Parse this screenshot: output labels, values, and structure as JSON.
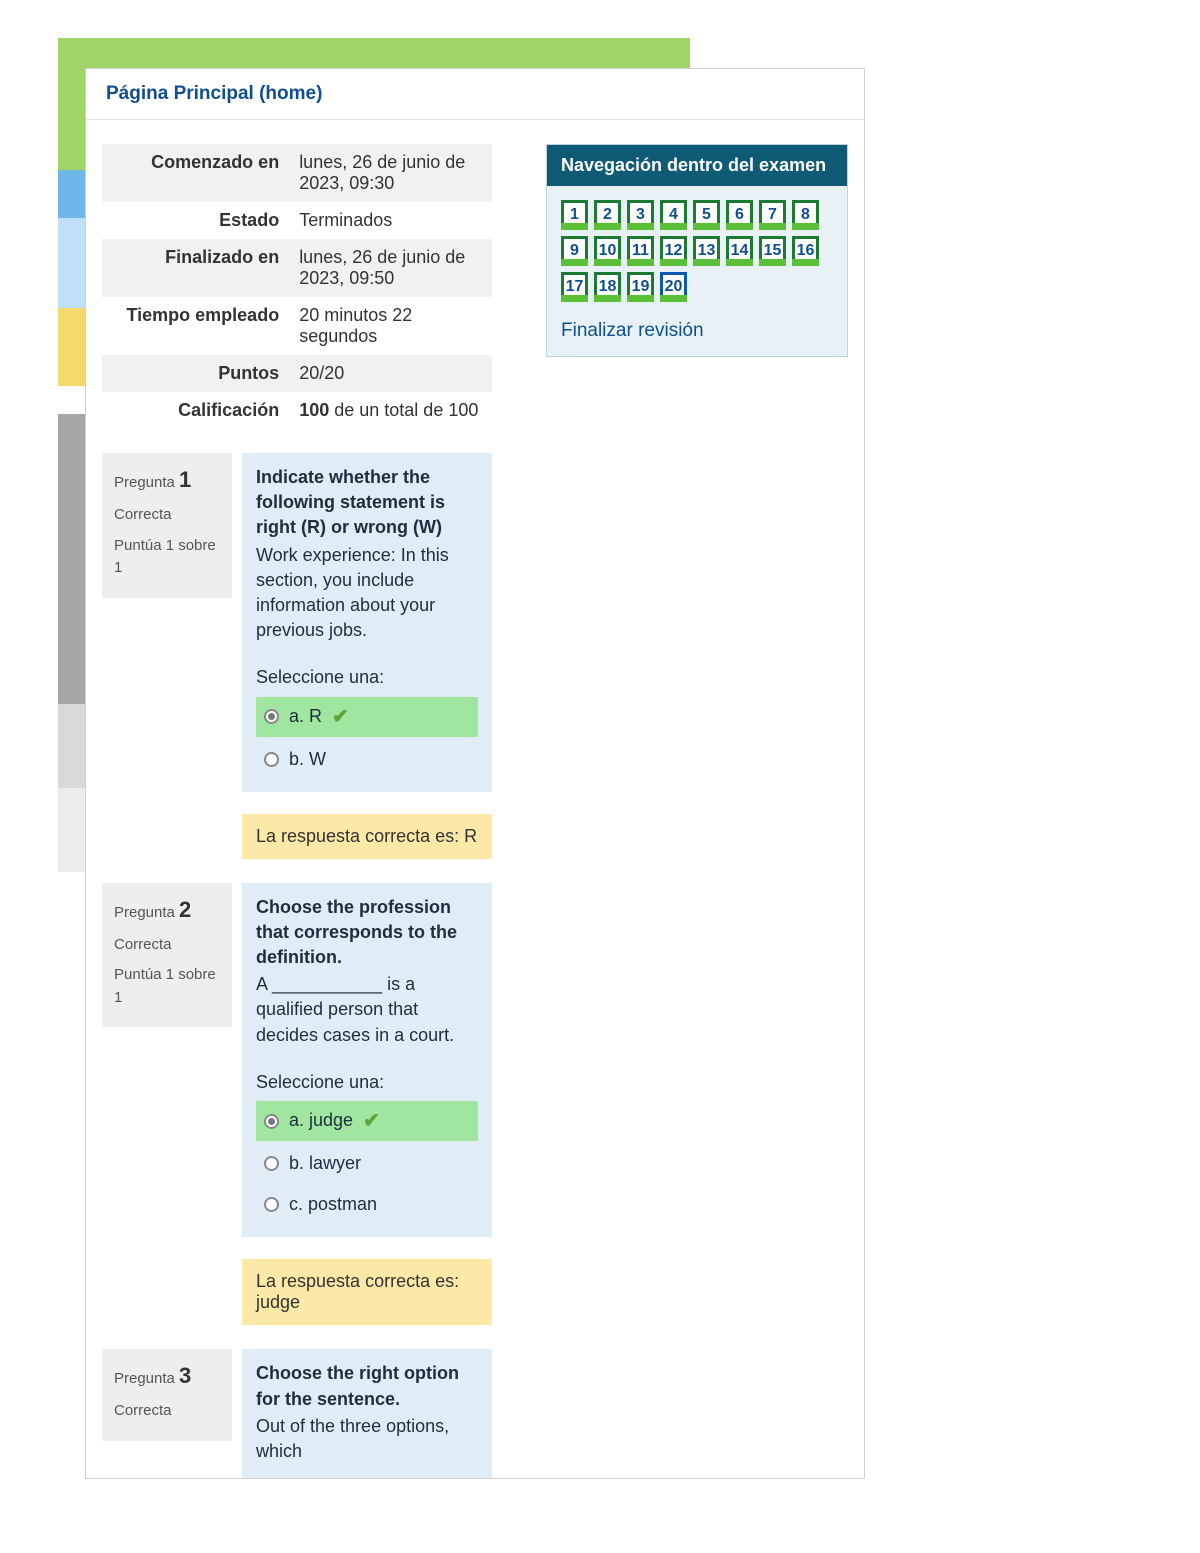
{
  "breadcrumb": {
    "home": "Página Principal (home)"
  },
  "summary": {
    "rows": [
      {
        "label": "Comenzado en",
        "value": "lunes, 26 de junio de 2023, 09:30"
      },
      {
        "label": "Estado",
        "value": "Terminados"
      },
      {
        "label": "Finalizado en",
        "value": "lunes, 26 de junio de 2023, 09:50"
      },
      {
        "label": "Tiempo empleado",
        "value": "20 minutos 22 segundos"
      },
      {
        "label": "Puntos",
        "value": "20/20"
      },
      {
        "label": "Calificación",
        "value_html": [
          "100",
          " de un total de 100"
        ]
      }
    ]
  },
  "labels": {
    "question_prefix": "Pregunta ",
    "select_one": "Seleccione una:",
    "correct_answer_prefix": "La respuesta correcta es: "
  },
  "questions": [
    {
      "number": "1",
      "state": "Correcta",
      "grade": "Puntúa 1 sobre 1",
      "stem": "Indicate whether the following statement is right (R) or wrong (W)",
      "body": "Work experience: In this section, you include information about your previous jobs.",
      "answers": [
        {
          "letter": "a.",
          "text": "R",
          "checked": true,
          "correct": true
        },
        {
          "letter": "b.",
          "text": "W",
          "checked": false,
          "correct": false
        }
      ],
      "correct_answer": "R"
    },
    {
      "number": "2",
      "state": "Correcta",
      "grade": "Puntúa 1 sobre 1",
      "stem": "Choose the profession that corresponds to the definition.",
      "body": "A ___________ is a qualified person that decides cases in a court.",
      "answers": [
        {
          "letter": "a.",
          "text": "judge",
          "checked": true,
          "correct": true
        },
        {
          "letter": "b.",
          "text": "lawyer",
          "checked": false,
          "correct": false
        },
        {
          "letter": "c.",
          "text": "postman",
          "checked": false,
          "correct": false
        }
      ],
      "correct_answer": "judge"
    },
    {
      "number": "3",
      "state": "Correcta",
      "grade": "",
      "stem": "Choose the right option for the sentence.",
      "body": "Out of the three options, which",
      "answers": [],
      "correct_answer": ""
    }
  ],
  "navigation": {
    "title": "Navegación dentro del examen",
    "count": 20,
    "current": 20,
    "finish_label": "Finalizar revisión"
  }
}
